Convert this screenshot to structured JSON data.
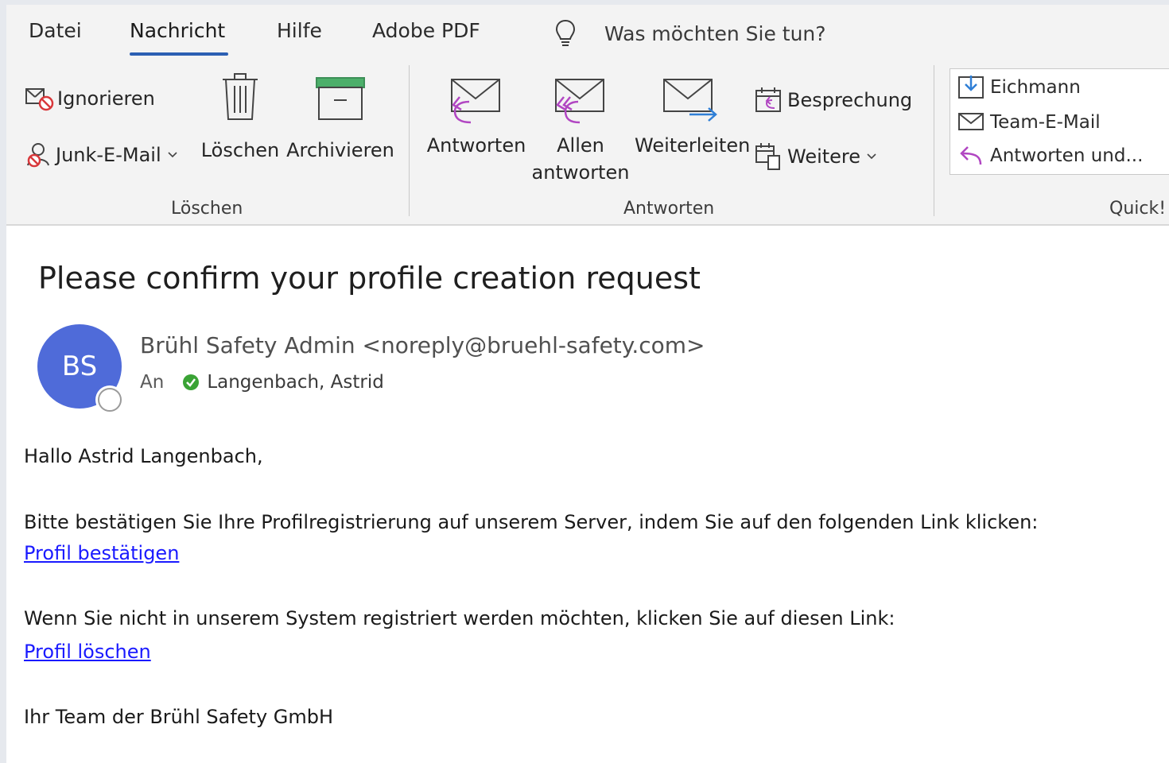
{
  "tabs": [
    {
      "label": "Datei",
      "active": false
    },
    {
      "label": "Nachricht",
      "active": true
    },
    {
      "label": "Hilfe",
      "active": false
    },
    {
      "label": "Adobe PDF",
      "active": false
    }
  ],
  "tell_me": {
    "text": "Was möchten Sie tun?",
    "icon": "lightbulb-icon"
  },
  "ribbon": {
    "groups": {
      "delete": {
        "label": "Löschen",
        "ignore": "Ignorieren",
        "junk": "Junk-E-Mail",
        "delete": "Löschen",
        "archive": "Archivieren"
      },
      "respond": {
        "label": "Antworten",
        "reply": "Antworten",
        "reply_all_line1": "Allen",
        "reply_all_line2": "antworten",
        "forward": "Weiterleiten",
        "meeting": "Besprechung",
        "more": "Weitere"
      },
      "quick_steps": {
        "label": "Quick!",
        "items": [
          "Eichmann",
          "Team-E-Mail",
          "Antworten und..."
        ]
      }
    }
  },
  "message": {
    "subject": "Please confirm your profile creation request",
    "avatar_initials": "BS",
    "sender": "Brühl Safety Admin <noreply@bruehl-safety.com>",
    "to_label": "An",
    "recipient": "Langenbach, Astrid",
    "greeting": "Hallo Astrid Langenbach,",
    "paragraph1": "Bitte bestätigen Sie Ihre Profilregistrierung auf unserem Server, indem Sie auf den folgenden Link klicken:",
    "link1": "Profil bestätigen",
    "paragraph2": "Wenn Sie nicht in unserem System registriert werden möchten, klicken Sie auf diesen Link:",
    "link2": "Profil löschen",
    "signature": "Ihr Team der Brühl Safety GmbH"
  },
  "colors": {
    "accent": "#2b5fb3",
    "avatar": "#4f6bd9",
    "link": "#1a1aff",
    "presence_ok": "#3aa335",
    "reply_arrow": "#b146c2",
    "forward_arrow": "#2f7fd6"
  }
}
